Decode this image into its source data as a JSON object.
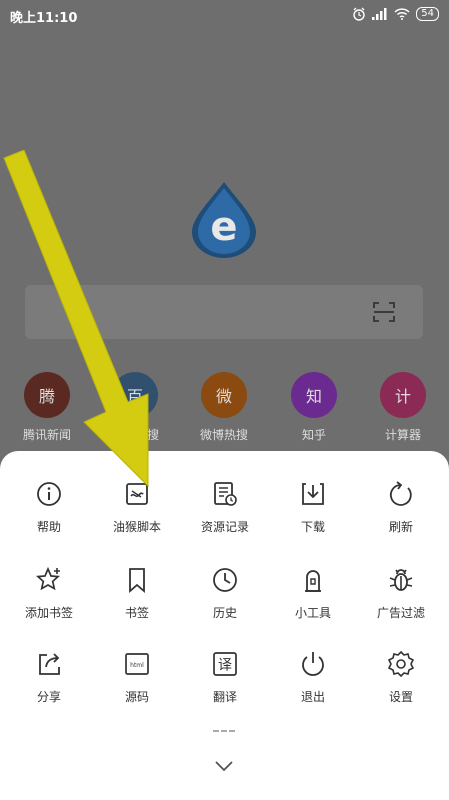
{
  "status_bar": {
    "time": "晚上11:10",
    "battery": "54"
  },
  "quick_links": [
    {
      "char": "腾",
      "label": "腾讯新闻",
      "color": "#5a2a22"
    },
    {
      "char": "百",
      "label": "百度热搜",
      "color": "#30506e"
    },
    {
      "char": "微",
      "label": "微博热搜",
      "color": "#8a4a10"
    },
    {
      "char": "知",
      "label": "知乎",
      "color": "#6a2a90"
    },
    {
      "char": "计",
      "label": "计算器",
      "color": "#8a2a55"
    }
  ],
  "menu": {
    "row1": [
      "帮助",
      "油猴脚本",
      "资源记录",
      "下载",
      "刷新"
    ],
    "row2": [
      "添加书签",
      "书签",
      "历史",
      "小工具",
      "广告过滤"
    ],
    "row3": [
      "分享",
      "源码",
      "翻译",
      "退出",
      "设置"
    ]
  },
  "colors": {
    "overlay": "#6e6e6e",
    "arrow": "#d4cc10",
    "sheet": "#ffffff"
  }
}
